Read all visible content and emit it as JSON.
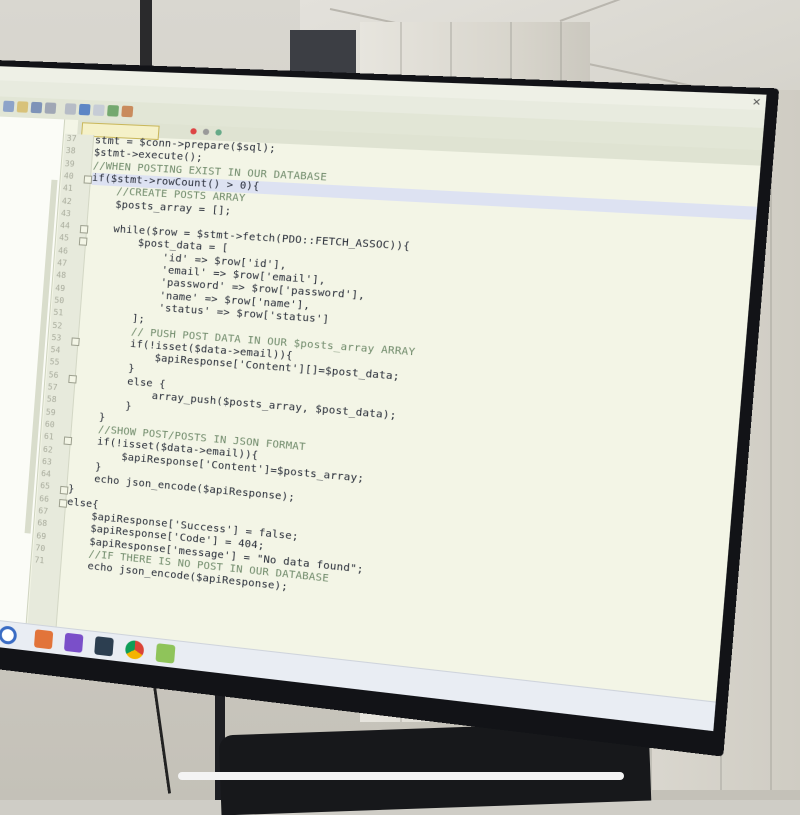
{
  "editor": {
    "line_numbers": [
      "37",
      "38",
      "39",
      "40",
      "41",
      "42",
      "43",
      "44",
      "45",
      "46",
      "47",
      "48",
      "49",
      "50",
      "51",
      "52",
      "53",
      "54",
      "55",
      "56",
      "57",
      "58",
      "59",
      "60",
      "61",
      "62",
      "63",
      "64",
      "65",
      "66",
      "67",
      "68",
      "69",
      "70",
      "71"
    ],
    "code_lines": [
      "stmt = $conn->prepare($sql);",
      "$stmt->execute();",
      "//WHEN POSTING EXIST IN OUR DATABASE",
      "if($stmt->rowCount() > 0){",
      "    //CREATE POSTS ARRAY",
      "    $posts_array = [];",
      "",
      "    while($row = $stmt->fetch(PDO::FETCH_ASSOC)){",
      "        $post_data = [",
      "            'id' => $row['id'],",
      "            'email' => $row['email'],",
      "            'password' => $row['password'],",
      "            'name' => $row['name'],",
      "            'status' => $row['status']",
      "        ];",
      "        // PUSH POST DATA IN OUR $posts_array ARRAY",
      "        if(!isset($data->email)){",
      "            $apiResponse['Content'][]=$post_data;",
      "        }",
      "        else {",
      "            array_push($posts_array, $post_data);",
      "        }",
      "    }",
      "    //SHOW POST/POSTS IN JSON FORMAT",
      "    if(!isset($data->email)){",
      "        $apiResponse['Content']=$posts_array;",
      "    }",
      "    echo json_encode($apiResponse);",
      "}",
      "else{",
      "    $apiResponse['Success'] = false;",
      "    $apiResponse['Code'] = 404;",
      "    $apiResponse['message'] = \"No data found\";",
      "    //IF THERE IS NO POST IN OUR DATABASE",
      "    echo json_encode($apiResponse);"
    ]
  }
}
